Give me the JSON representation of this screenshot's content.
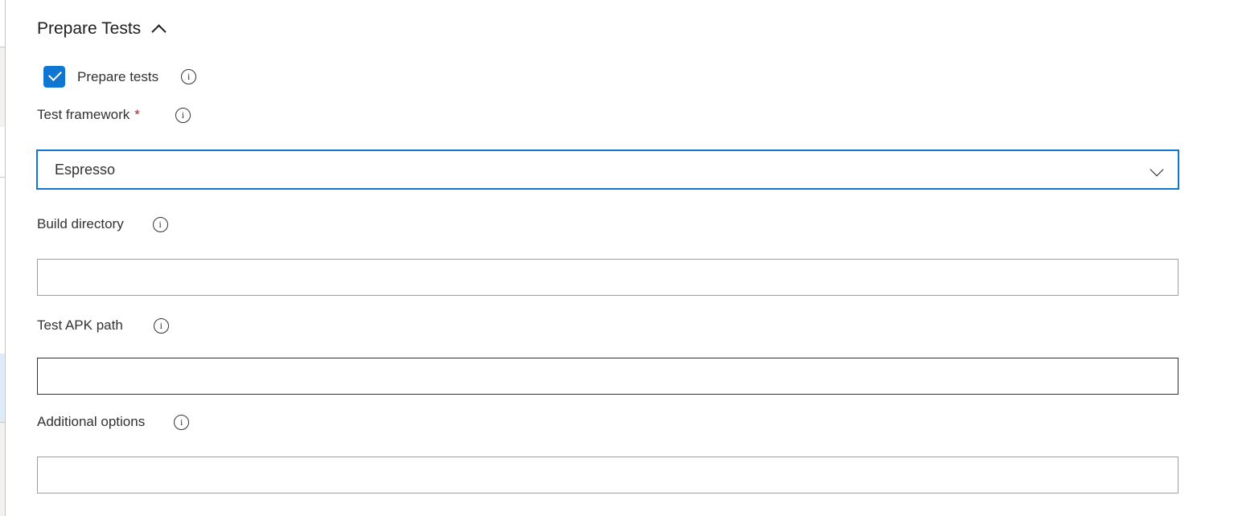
{
  "section": {
    "title": "Prepare Tests",
    "collapse_icon": "chevron-up-icon",
    "expanded": true
  },
  "checkbox": {
    "label": "Prepare tests",
    "checked": true,
    "checkmark": "check-icon",
    "info_icon": "info-icon",
    "accent_color": "#0f77d2"
  },
  "fields": [
    {
      "label": "Test framework",
      "required": true,
      "required_marker": "*",
      "required_color": "#a4262c",
      "info_icon": "info-icon",
      "control": "dropdown",
      "value": "Espresso",
      "placeholder": "",
      "chevron_icon": "chevron-down-icon",
      "focused": true,
      "border_color": "#0f77d2"
    },
    {
      "label": "Build directory",
      "required": false,
      "required_marker": "",
      "info_icon": "info-icon",
      "control": "textbox",
      "value": "",
      "placeholder": "",
      "focused": false,
      "border_color": "#a19f9d"
    },
    {
      "label": "Test APK path",
      "required": false,
      "required_marker": "",
      "info_icon": "info-icon",
      "control": "textbox",
      "value": "",
      "placeholder": "",
      "focused": false,
      "hovered": true,
      "border_color": "#323130"
    },
    {
      "label": "Additional options",
      "required": false,
      "required_marker": "",
      "info_icon": "info-icon",
      "control": "textbox",
      "value": "",
      "placeholder": "",
      "focused": false,
      "border_color": "#a19f9d"
    }
  ],
  "icon_glyphs": {
    "info": "i"
  },
  "colors": {
    "text": "#323130",
    "heading": "#201f1e",
    "accent": "#0f77d2",
    "border": "#a19f9d",
    "border_hover": "#323130",
    "required": "#a4262c",
    "rail_gray": "#f3f2f1",
    "rail_blue": "#deecf9",
    "rail_line": "#c8c6c4"
  }
}
